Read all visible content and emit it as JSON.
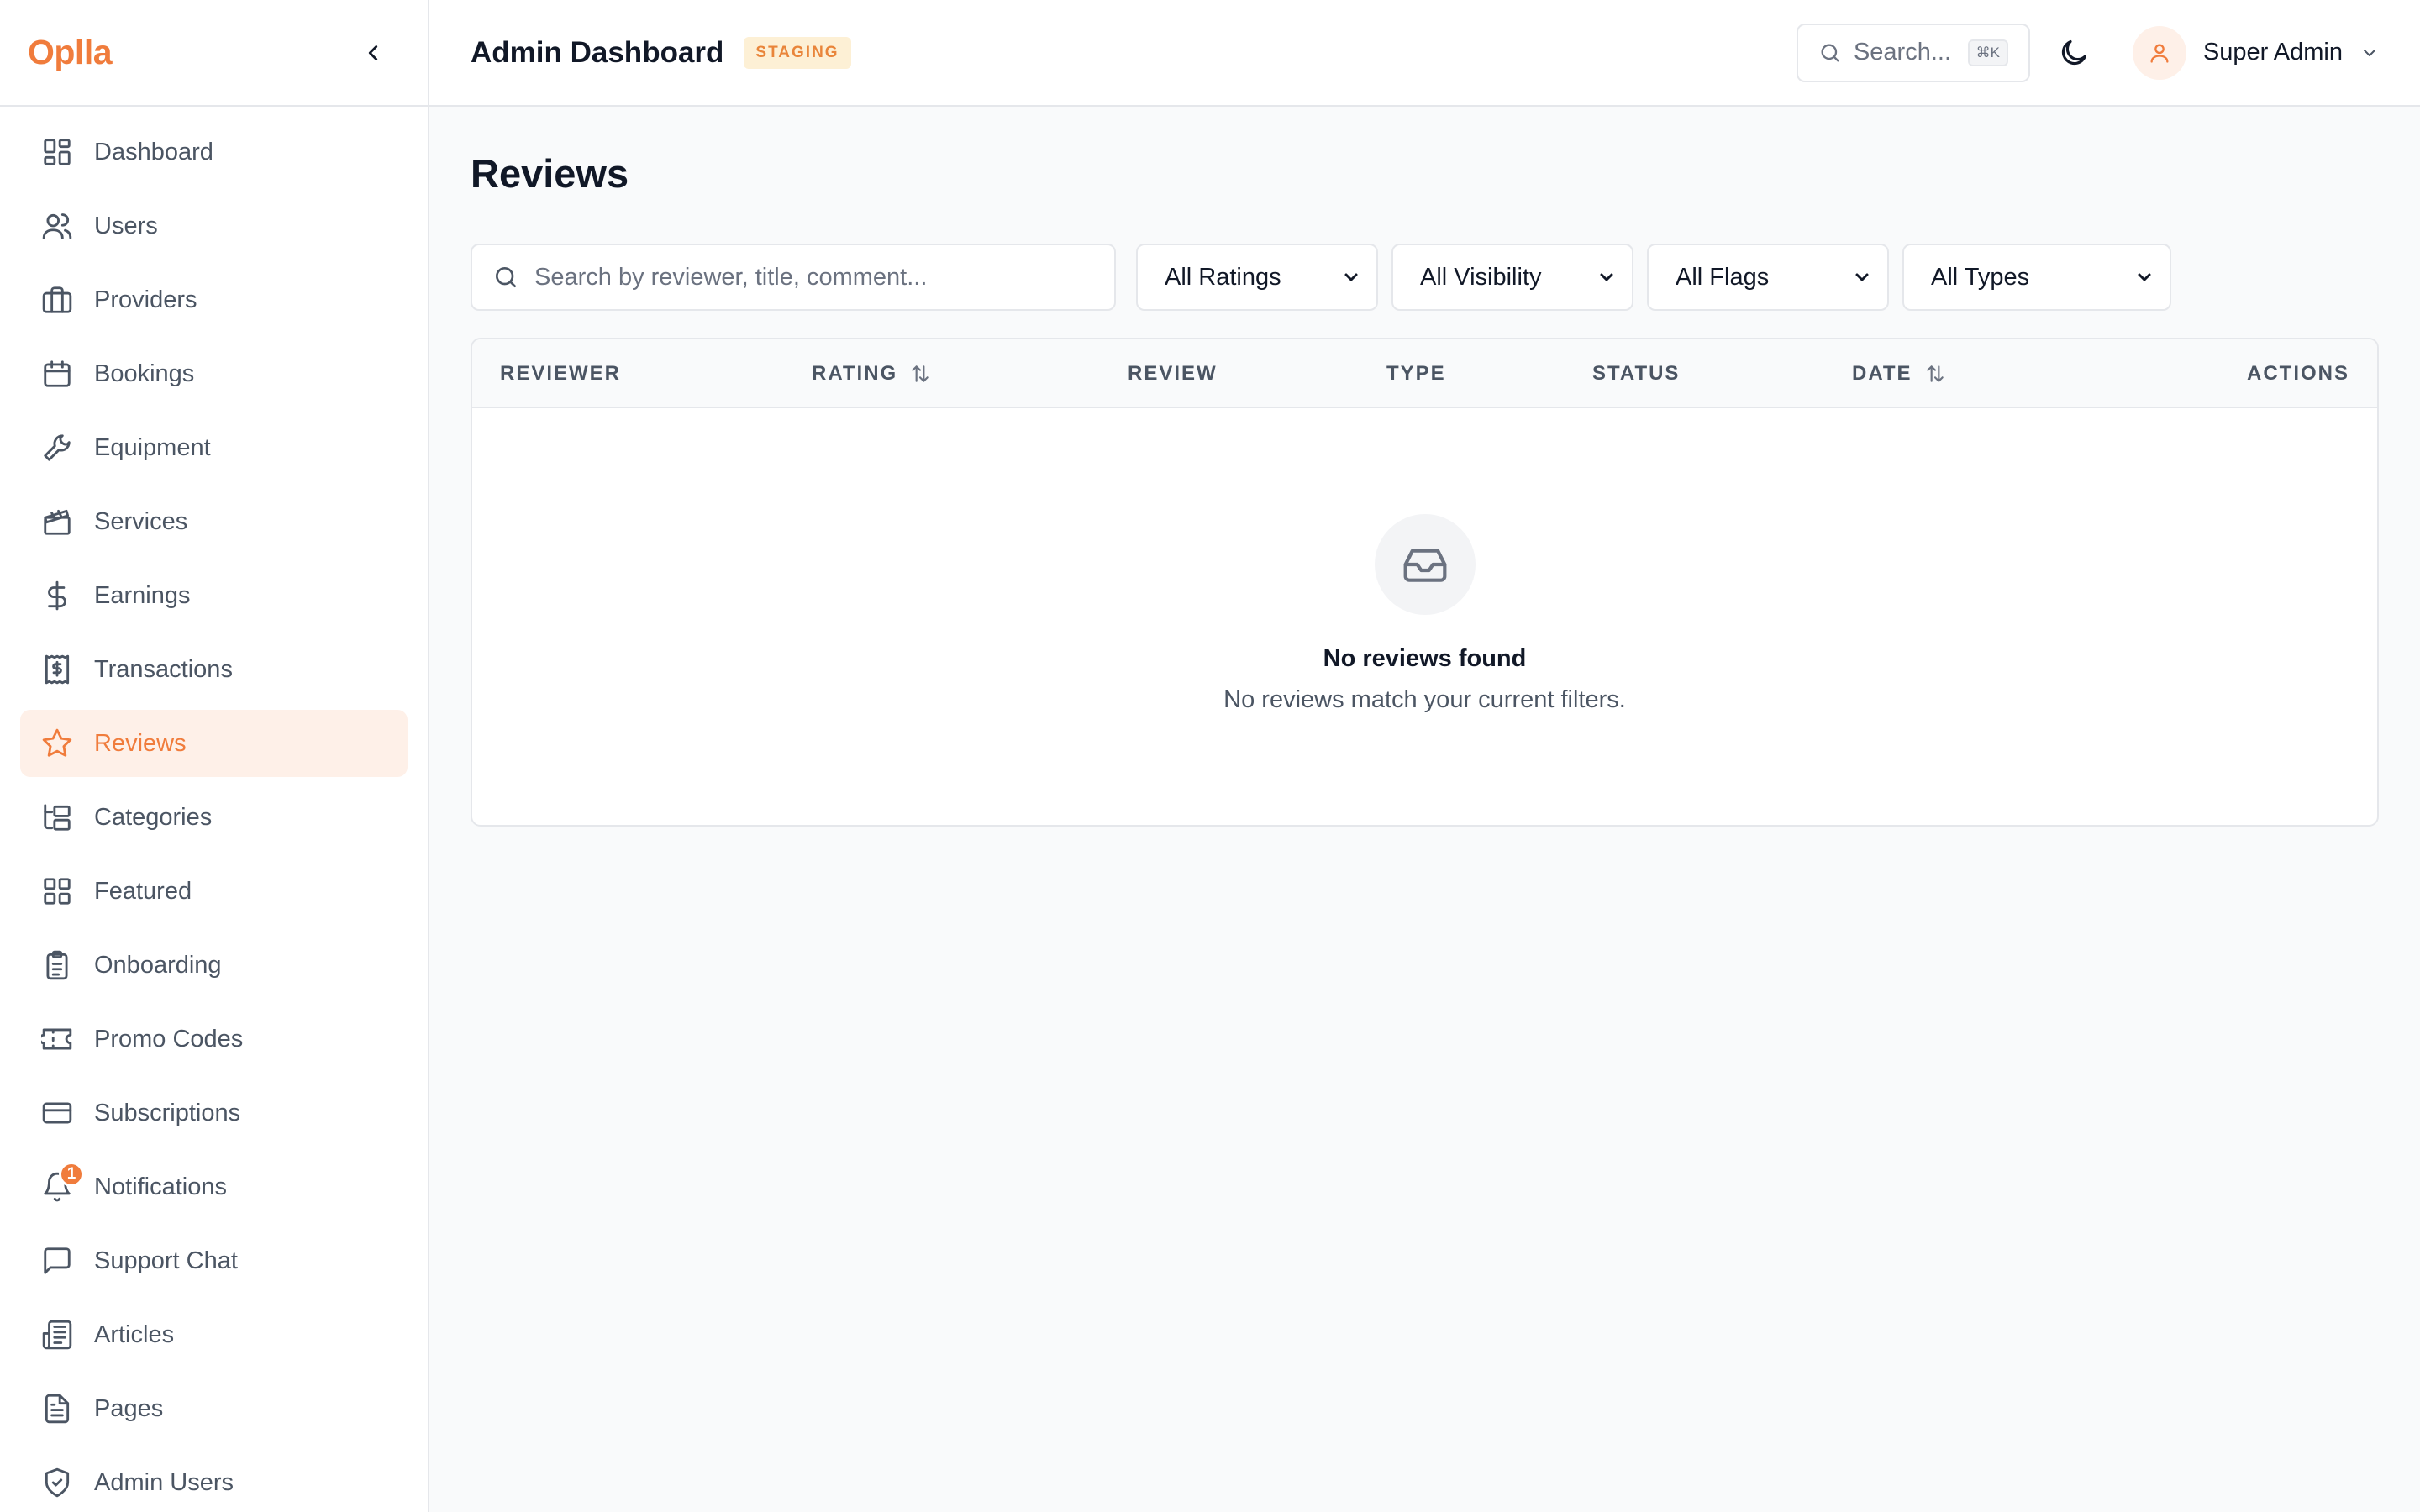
{
  "brand": {
    "name": "Oplla",
    "accent": "#f07c3c"
  },
  "sidebar": {
    "items": [
      {
        "label": "Dashboard",
        "icon": "dashboard-icon"
      },
      {
        "label": "Users",
        "icon": "users-icon"
      },
      {
        "label": "Providers",
        "icon": "briefcase-icon"
      },
      {
        "label": "Bookings",
        "icon": "calendar-icon"
      },
      {
        "label": "Equipment",
        "icon": "wrench-icon"
      },
      {
        "label": "Services",
        "icon": "clapperboard-icon"
      },
      {
        "label": "Earnings",
        "icon": "dollar-icon"
      },
      {
        "label": "Transactions",
        "icon": "receipt-icon"
      },
      {
        "label": "Reviews",
        "icon": "star-icon",
        "active": true
      },
      {
        "label": "Categories",
        "icon": "folder-tree-icon"
      },
      {
        "label": "Featured",
        "icon": "grid-icon"
      },
      {
        "label": "Onboarding",
        "icon": "clipboard-icon"
      },
      {
        "label": "Promo Codes",
        "icon": "ticket-icon"
      },
      {
        "label": "Subscriptions",
        "icon": "credit-card-icon"
      },
      {
        "label": "Notifications",
        "icon": "bell-icon",
        "badge": "1"
      },
      {
        "label": "Support Chat",
        "icon": "message-icon"
      },
      {
        "label": "Articles",
        "icon": "newspaper-icon"
      },
      {
        "label": "Pages",
        "icon": "file-icon"
      },
      {
        "label": "Admin Users",
        "icon": "shield-icon"
      }
    ]
  },
  "header": {
    "title": "Admin Dashboard",
    "env_badge": "STAGING",
    "search_placeholder": "Search...",
    "search_shortcut": "⌘K",
    "user_name": "Super Admin"
  },
  "page": {
    "title": "Reviews",
    "search_placeholder": "Search by reviewer, title, comment...",
    "filters": {
      "ratings": "All Ratings",
      "visibility": "All Visibility",
      "flags": "All Flags",
      "types": "All Types"
    },
    "table": {
      "columns": [
        "REVIEWER",
        "RATING",
        "REVIEW",
        "TYPE",
        "STATUS",
        "DATE",
        "ACTIONS"
      ],
      "sortable": [
        "RATING",
        "DATE"
      ],
      "rows": []
    },
    "empty_state": {
      "title": "No reviews found",
      "subtitle": "No reviews match your current filters.",
      "icon": "inbox-icon"
    }
  }
}
